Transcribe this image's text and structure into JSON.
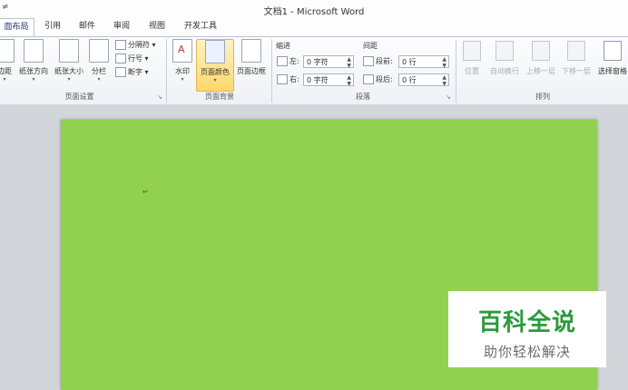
{
  "window": {
    "title": "文档1 - Microsoft Word",
    "qat_fragment": "≠"
  },
  "tabs": [
    {
      "label": "面布局",
      "active": true
    },
    {
      "label": "引用"
    },
    {
      "label": "邮件"
    },
    {
      "label": "审阅"
    },
    {
      "label": "视图"
    },
    {
      "label": "开发工具"
    }
  ],
  "page_setup": {
    "label": "页面设置",
    "margins": "边距",
    "orientation": "纸张方向",
    "size": "纸张大小",
    "columns": "分栏",
    "breaks": "分隔符",
    "line_numbers": "行号",
    "hyphenation": "断字"
  },
  "page_background": {
    "label": "页面背景",
    "watermark": "水印",
    "page_color": "页面颜色",
    "page_borders": "页面边框"
  },
  "paragraph": {
    "label": "段落",
    "indent_heading": "缩进",
    "spacing_heading": "间距",
    "left_label": "左:",
    "left_value": "0 字符",
    "right_label": "右:",
    "right_value": "0 字符",
    "before_label": "段前:",
    "before_value": "0 行",
    "after_label": "段后:",
    "after_value": "0 行"
  },
  "arrange": {
    "label": "排列",
    "position": "位置",
    "wrap_text": "自动换行",
    "bring_forward": "上移一层",
    "send_backward": "下移一层",
    "selection_pane": "选择窗格"
  },
  "document": {
    "paragraph_mark": "↵",
    "page_color": "#92d050"
  },
  "watermark_badge": {
    "title": "百科全说",
    "subtitle": "助你轻松解决"
  }
}
